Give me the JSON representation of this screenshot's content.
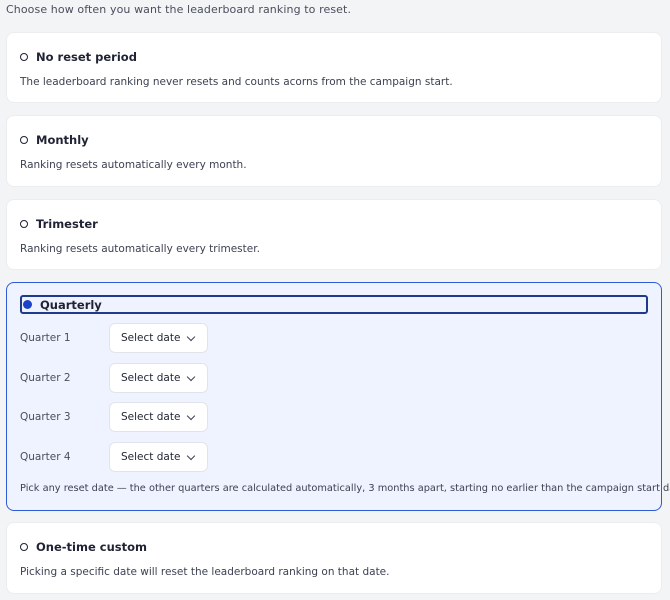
{
  "intro": "Choose how often you want the leaderboard ranking to reset.",
  "options": [
    {
      "title": "No reset period",
      "description": "The leaderboard ranking never resets and counts acorns from the campaign start."
    },
    {
      "title": "Monthly",
      "description": "Ranking resets automatically every month."
    },
    {
      "title": "Trimester",
      "description": "Ranking resets automatically every trimester."
    },
    {
      "title": "Quarterly",
      "selected": true,
      "quarters": [
        {
          "label": "Quarter 1",
          "value": "Select date"
        },
        {
          "label": "Quarter 2",
          "value": "Select date"
        },
        {
          "label": "Quarter 3",
          "value": "Select date"
        },
        {
          "label": "Quarter 4",
          "value": "Select date"
        }
      ],
      "note": "Pick any reset date — the other quarters are calculated automatically, 3 months apart, starting no earlier than the campaign start date."
    },
    {
      "title": "One-time custom",
      "description": "Picking a specific date will reset the leaderboard ranking on that date."
    }
  ],
  "colors": {
    "accent": "#1d44c8",
    "selected_bg": "#eef3ff",
    "selected_border": "#2e5bd6"
  },
  "icons": {
    "radio_empty": "radio-empty-icon",
    "radio_filled": "radio-filled-icon",
    "dropdown": "chevron-down-icon"
  }
}
